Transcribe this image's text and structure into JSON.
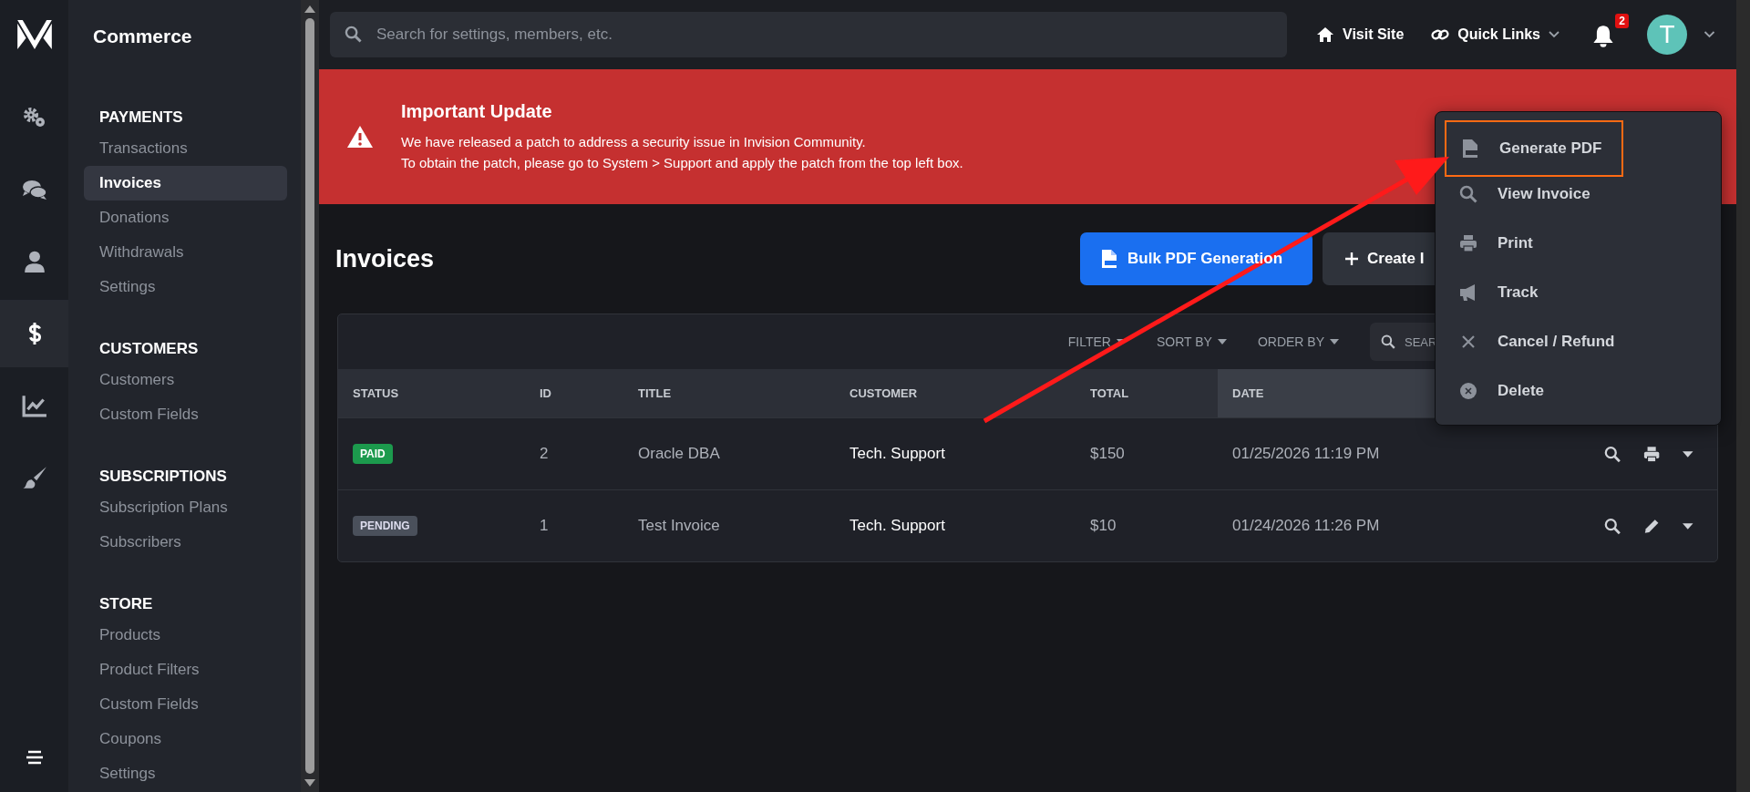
{
  "rail": {
    "items": [
      {
        "kind": "gears",
        "selected": false
      },
      {
        "kind": "chat",
        "selected": false
      },
      {
        "kind": "user",
        "selected": false
      },
      {
        "kind": "dollar",
        "selected": true
      },
      {
        "kind": "chart",
        "selected": false
      },
      {
        "kind": "brush",
        "selected": false
      }
    ]
  },
  "sidebar": {
    "title": "Commerce",
    "sections": [
      {
        "heading": "PAYMENTS",
        "items": [
          {
            "label": "Transactions",
            "selected": false
          },
          {
            "label": "Invoices",
            "selected": true
          },
          {
            "label": "Donations",
            "selected": false
          },
          {
            "label": "Withdrawals",
            "selected": false
          },
          {
            "label": "Settings",
            "selected": false
          }
        ]
      },
      {
        "heading": "CUSTOMERS",
        "items": [
          {
            "label": "Customers",
            "selected": false
          },
          {
            "label": "Custom Fields",
            "selected": false
          }
        ]
      },
      {
        "heading": "SUBSCRIPTIONS",
        "items": [
          {
            "label": "Subscription Plans",
            "selected": false
          },
          {
            "label": "Subscribers",
            "selected": false
          }
        ]
      },
      {
        "heading": "STORE",
        "items": [
          {
            "label": "Products",
            "selected": false
          },
          {
            "label": "Product Filters",
            "selected": false
          },
          {
            "label": "Custom Fields",
            "selected": false
          },
          {
            "label": "Coupons",
            "selected": false
          },
          {
            "label": "Settings",
            "selected": false
          }
        ]
      }
    ]
  },
  "topbar": {
    "search": {
      "placeholder": "Search for settings, members, etc."
    },
    "visit_site": "Visit Site",
    "quick_links": "Quick Links",
    "notifications": "2",
    "avatar": "T"
  },
  "alert": {
    "title": "Important Update",
    "lines": [
      "We have released a patch to address a security issue in Invision Community.",
      "To obtain the patch, please go to System > Support and apply the patch from the top left box."
    ]
  },
  "page": {
    "title": "Invoices",
    "buttons": [
      {
        "label": "Bulk PDF Generation",
        "kind": "primary"
      },
      {
        "label": "Create I",
        "kind": "secondary"
      }
    ]
  },
  "table": {
    "toolbar": [
      "FILTER",
      "SORT BY",
      "ORDER BY"
    ],
    "search": {
      "placeholder": "SEAR"
    },
    "columns": [
      {
        "label": "STATUS",
        "sorted": false
      },
      {
        "label": "ID",
        "sorted": false
      },
      {
        "label": "TITLE",
        "sorted": false
      },
      {
        "label": "CUSTOMER",
        "sorted": false
      },
      {
        "label": "TOTAL",
        "sorted": false
      },
      {
        "label": "DATE",
        "sorted": true
      }
    ],
    "rows": [
      {
        "status": {
          "label": "PAID",
          "kind": "paid"
        },
        "id": "2",
        "title": "Oracle DBA",
        "customer": "Tech. Support",
        "total": "$150",
        "date": "01/25/2026 11:19 PM",
        "actions": [
          {
            "kind": "search"
          },
          {
            "kind": "print"
          },
          {
            "kind": "caret"
          }
        ]
      },
      {
        "status": {
          "label": "PENDING",
          "kind": "pending"
        },
        "id": "1",
        "title": "Test Invoice",
        "customer": "Tech. Support",
        "total": "$10",
        "date": "01/24/2026 11:26 PM",
        "actions": [
          {
            "kind": "search"
          },
          {
            "kind": "pencil"
          },
          {
            "kind": "caret"
          }
        ]
      }
    ]
  },
  "menu": {
    "items": [
      {
        "label": "Generate PDF",
        "kind": "pdf",
        "highlighted": true
      },
      {
        "label": "View Invoice",
        "kind": "search",
        "highlighted": false
      },
      {
        "label": "Print",
        "kind": "print",
        "highlighted": false
      },
      {
        "label": "Track",
        "kind": "megaphone",
        "highlighted": false
      },
      {
        "label": "Cancel / Refund",
        "kind": "x",
        "highlighted": false
      },
      {
        "label": "Delete",
        "kind": "delete",
        "highlighted": false
      }
    ]
  }
}
